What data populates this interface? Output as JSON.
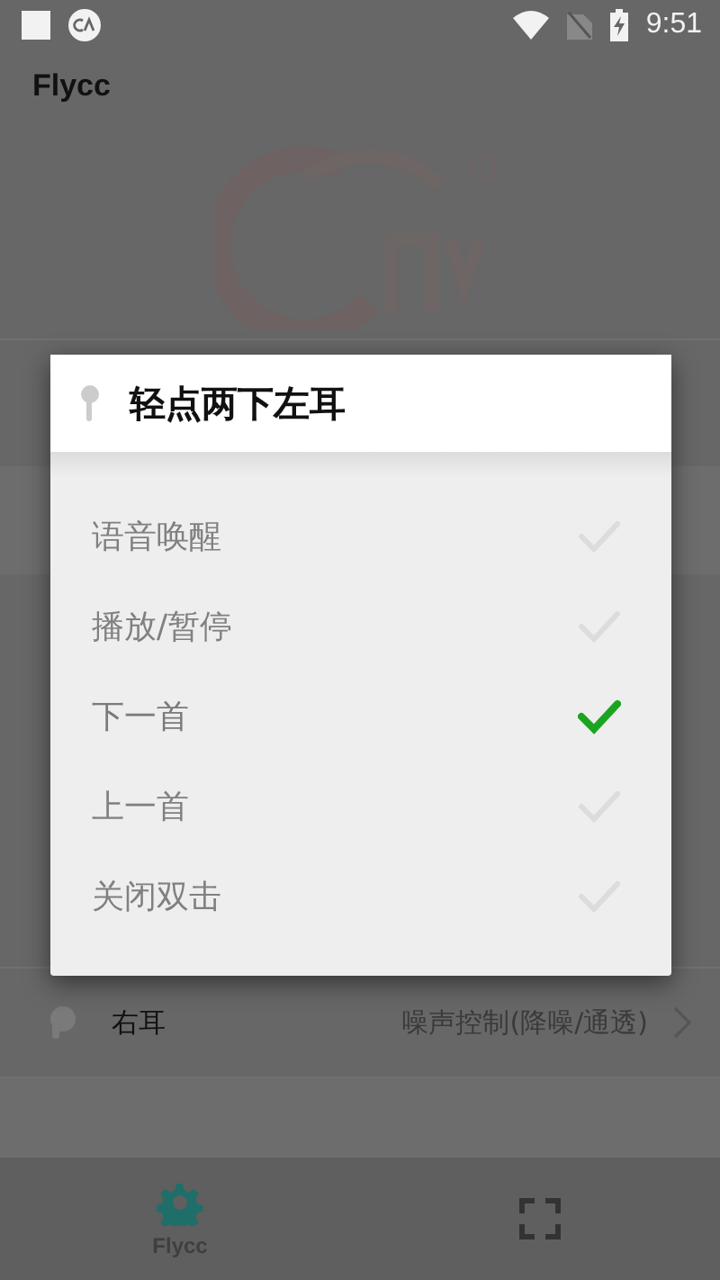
{
  "status_bar": {
    "time": "9:51"
  },
  "app_bar": {
    "title": "Flycc"
  },
  "settings": [
    {
      "label": "右耳",
      "value": "噪声控制(降噪/通透)"
    }
  ],
  "bottom_nav": [
    {
      "label": "Flycc",
      "selected": true
    },
    {
      "selected": false
    }
  ],
  "dialog": {
    "title": "轻点两下左耳",
    "options": [
      {
        "label": "语音唤醒",
        "selected": false
      },
      {
        "label": "播放/暂停",
        "selected": false
      },
      {
        "label": "下一首",
        "selected": true
      },
      {
        "label": "上一首",
        "selected": false
      },
      {
        "label": "关闭双击",
        "selected": false
      }
    ]
  }
}
